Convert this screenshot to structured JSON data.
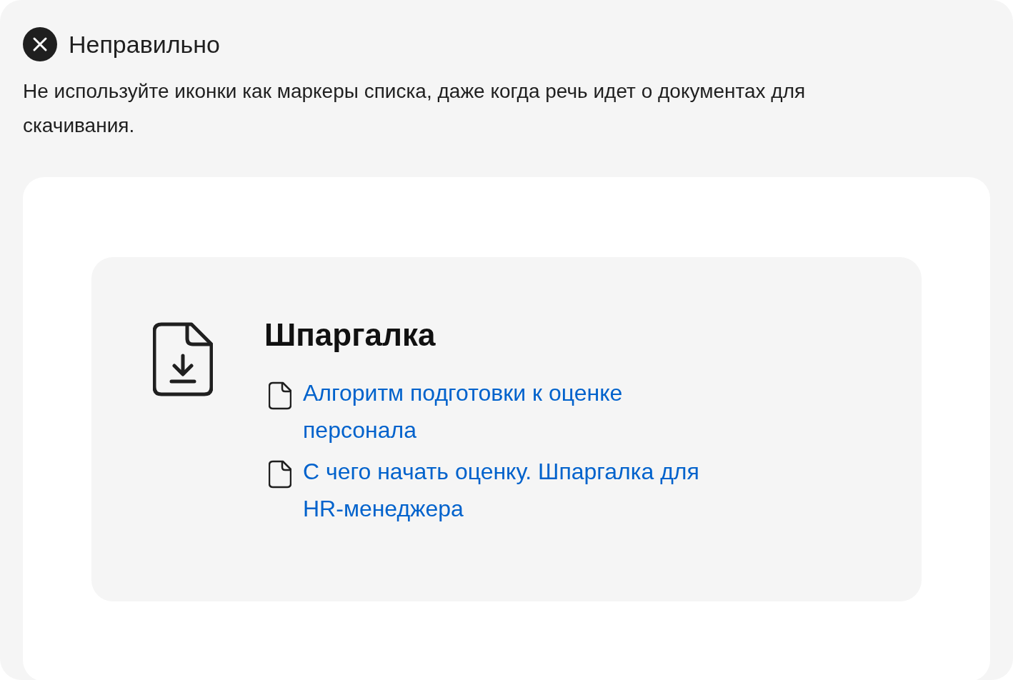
{
  "verdict": {
    "kind": "wrong",
    "title": "Неправильно",
    "description": "Не используйте иконки как маркеры списка, даже когда речь идет о документах для скачивания."
  },
  "example": {
    "title": "Шпаргалка",
    "links": [
      {
        "text": "Алгоритм подготовки к оценке персонала"
      },
      {
        "text": "С чего начать оценку. Шпаргалка для HR-менеджера"
      }
    ]
  }
}
